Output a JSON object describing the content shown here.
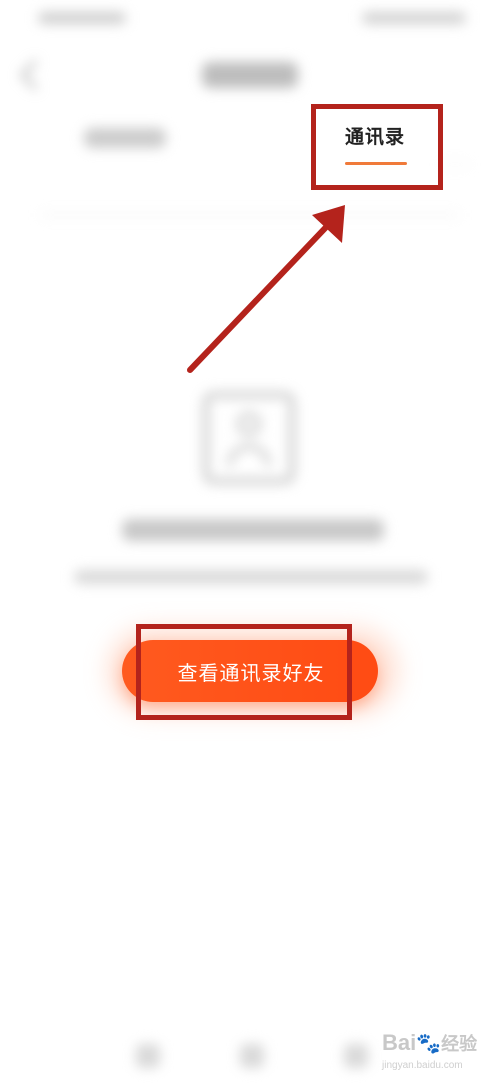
{
  "tabs": {
    "contacts_label": "通讯录"
  },
  "main": {
    "cta_label": "查看通讯录好友"
  },
  "watermark": {
    "brand": "Bai",
    "brand_suffix": "经验",
    "url": "jingyan.baidu.com"
  },
  "colors": {
    "accent": "#ff5a1f",
    "annotation": "#b4231c",
    "tab_underline": "#f07a3a"
  }
}
